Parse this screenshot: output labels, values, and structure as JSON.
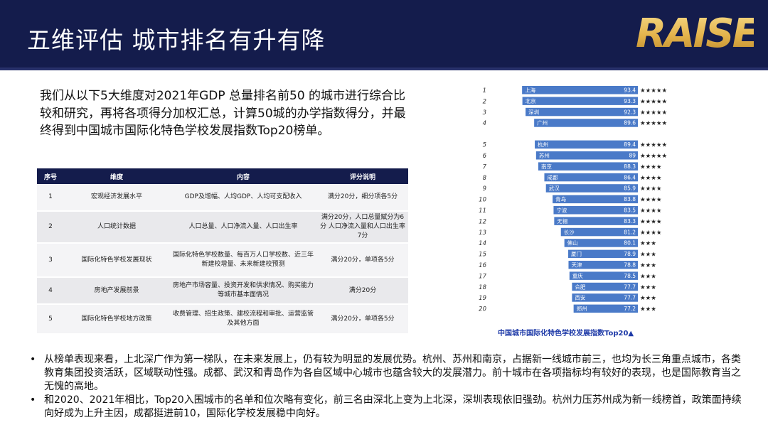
{
  "header": {
    "title": "五维评估 城市排名有升有降",
    "logo_text": "RAISE",
    "bg_color": "#141c4c"
  },
  "intro": {
    "text": "我们从以下5大维度对2021年GDP 总量排名前50 的城市进行综合比较和研究，再将各项得分加权汇总，计算50城的办学指数得分，并最终得到中国城市国际化特色学校发展指数Top20榜单。"
  },
  "criteria_table": {
    "headers": [
      "序号",
      "维度",
      "内容",
      "评分说明"
    ],
    "rows": [
      {
        "no": "1",
        "dimension": "宏观经济发展水平",
        "content": "GDP及增幅、人均GDP、人均可支配收入",
        "scoring": "满分20分，细分项各5分"
      },
      {
        "no": "2",
        "dimension": "人口统计数据",
        "content": "人口总量、人口净流入量、人口出生率",
        "scoring": "满分20分，人口总量赋分为6分 人口净流入量和人口出生率7分"
      },
      {
        "no": "3",
        "dimension": "国际化特色学校发展现状",
        "content": "国际化特色学校数量、每百万人口学校数、近三年新建校增量、未来新建校预测",
        "scoring": "满分20分，单项各5分"
      },
      {
        "no": "4",
        "dimension": "房地产发展前景",
        "content": "房地产市场容量、投资开发和供求情况、购买能力等城市基本面情况",
        "scoring": "满分20分"
      },
      {
        "no": "5",
        "dimension": "国际化特色学校地方政策",
        "content": "收费管理、招生政策、建校流程和审批、运营监管及其他方面",
        "scoring": "满分20分，单项各5分"
      }
    ]
  },
  "chart_data": {
    "type": "bar",
    "orientation": "horizontal",
    "title": "中国城市国际化特色学校发展指数Top20▲",
    "ranks": [
      "1",
      "2",
      "3",
      "4",
      "5",
      "6",
      "7",
      "8",
      "9",
      "10",
      "11",
      "12",
      "13",
      "14",
      "15",
      "16",
      "17",
      "18",
      "19",
      "20"
    ],
    "categories": [
      "上海",
      "北京",
      "深圳",
      "广州",
      "杭州",
      "苏州",
      "南京",
      "成都",
      "武汉",
      "青岛",
      "宁波",
      "无锡",
      "长沙",
      "佛山",
      "厦门",
      "天津",
      "重庆",
      "合肥",
      "西安",
      "郑州"
    ],
    "values": [
      93.4,
      93.3,
      92.3,
      89.6,
      89.4,
      89,
      88.3,
      86.4,
      85.9,
      83.8,
      83.5,
      83.3,
      81.2,
      80.1,
      78.9,
      78.8,
      78.5,
      77.7,
      77.7,
      77.2
    ],
    "value_labels": [
      "93.4",
      "93.3",
      "92.3",
      "89.6",
      "89.4",
      "89",
      "88.3",
      "86.4",
      "85.9",
      "83.8",
      "83.5",
      "83.3",
      "81.2",
      "80.1",
      "78.9",
      "78.8",
      "78.5",
      "77.7",
      "77.7",
      "77.2"
    ],
    "stars": [
      "★★★★★",
      "★★★★★",
      "★★★★★",
      "★★★★★",
      "★★★★★",
      "★★★★★",
      "★★★★",
      "★★★★",
      "★★★★",
      "★★★★",
      "★★★★",
      "★★★★",
      "★★★★",
      "★★★",
      "★★★",
      "★★★",
      "★★★",
      "★★★",
      "★★★",
      "★★★"
    ],
    "group_gap_after_rank": 4,
    "xlim": [
      57,
      95
    ],
    "bar_color": "#4a7ac8",
    "star_color": "#222222"
  },
  "bullets": [
    "从榜单表现来看，上北深广作为第一梯队，在未来发展上，仍有较为明显的发展优势。杭州、苏州和南京，占据新一线城市前三，也均为长三角重点城市，各类教育集团投资活跃，区域联动性强。成都、武汉和青岛作为各自区域中心城市也蕴含较大的发展潜力。前十城市在各项指标均有较好的表现，也是国际教育当之无愧的高地。",
    "和2020、2021年相比，Top20入围城市的名单和位次略有变化，前三名由深北上变为上北深，深圳表现依旧强劲。杭州力压苏州成为新一线榜首，政策面持续向好成为上升主因，成都挺进前10，国际化学校发展稳中向好。"
  ]
}
